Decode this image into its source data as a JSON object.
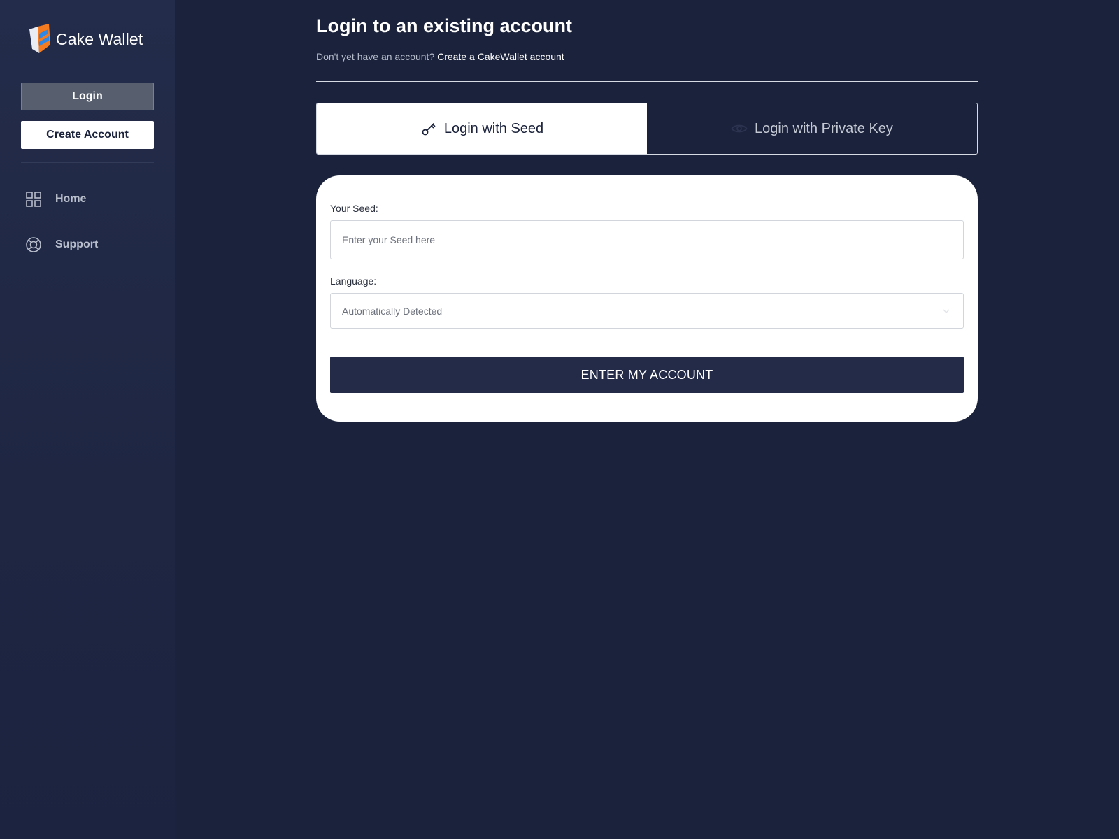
{
  "brand": {
    "name": "Cake Wallet",
    "icon": "cake-wallet-logo"
  },
  "sidebar": {
    "login_label": "Login",
    "create_label": "Create Account",
    "nav": [
      {
        "label": "Home",
        "icon": "grid-icon"
      },
      {
        "label": "Support",
        "icon": "lifebuoy-icon"
      }
    ]
  },
  "header": {
    "title": "Login to an existing account",
    "no_account_text": "Don't yet have an account?",
    "create_link": "Create a CakeWallet account"
  },
  "tabs": [
    {
      "label": "Login with Seed",
      "icon": "key-icon",
      "active": true
    },
    {
      "label": "Login with Private Key",
      "icon": "eye-icon",
      "active": false
    }
  ],
  "form": {
    "seed_label": "Your Seed:",
    "seed_placeholder": "Enter your Seed here",
    "seed_value": "",
    "language_label": "Language:",
    "language_value": "Automatically Detected",
    "submit_label": "ENTER MY ACCOUNT"
  },
  "colors": {
    "background": "#1b223b",
    "sidebar": "#232c4a",
    "button_dark": "#232b49",
    "logo_orange": "#f47b20",
    "logo_blue": "#2f87e6"
  }
}
